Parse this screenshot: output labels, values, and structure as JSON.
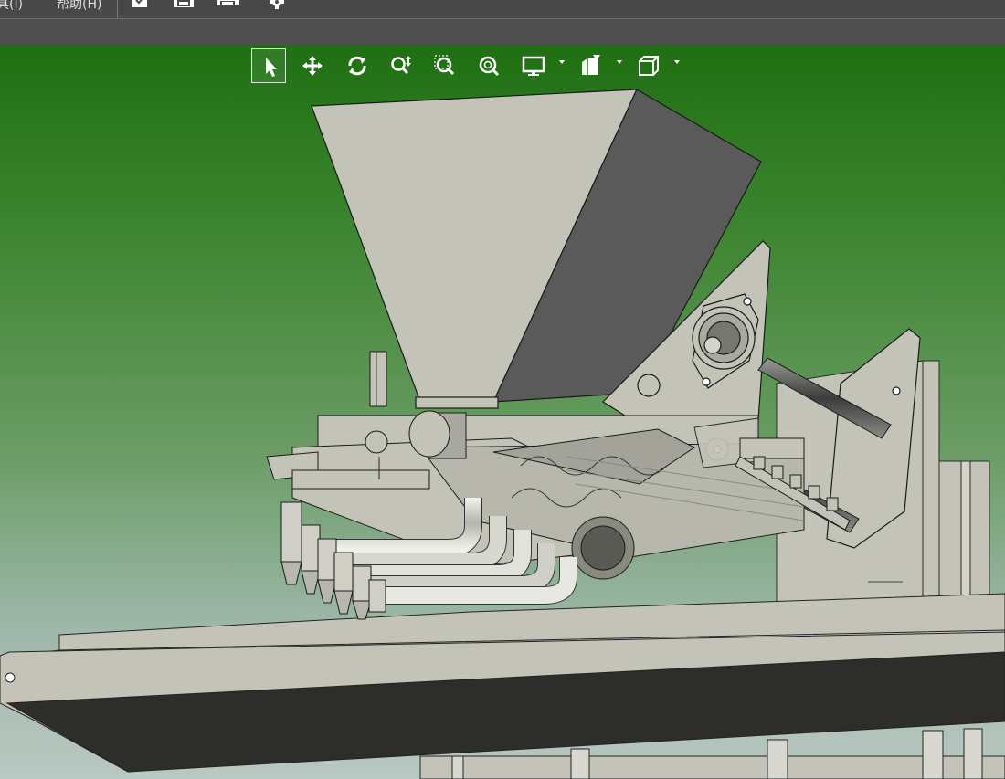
{
  "menubar": {
    "items": [
      {
        "label": "具(I)"
      },
      {
        "label": "帮助(H)"
      }
    ],
    "icons": [
      "check-document-icon",
      "save-icon",
      "print-icon",
      "settings-icon"
    ]
  },
  "view_toolbar": {
    "tools": [
      {
        "name": "select",
        "icon": "cursor-arrow-icon",
        "active": true
      },
      {
        "name": "pan",
        "icon": "move-arrows-icon"
      },
      {
        "name": "rotate",
        "icon": "rotate-icon"
      },
      {
        "name": "zoom",
        "icon": "zoom-updown-icon"
      },
      {
        "name": "zoom-window",
        "icon": "zoom-window-icon"
      },
      {
        "name": "zoom-fit",
        "icon": "zoom-fit-icon"
      },
      {
        "name": "display-style",
        "icon": "monitor-icon",
        "dropdown": true
      },
      {
        "name": "section-view",
        "icon": "section-view-icon",
        "dropdown": true
      },
      {
        "name": "standard-views",
        "icon": "cube-icon",
        "dropdown": true
      }
    ]
  },
  "viewport": {
    "background_top": "#1f6f12",
    "background_bottom": "#b9c8c2",
    "model_color": "#c4c3b8",
    "shadow_color": "#5a5a5a",
    "belt_color": "#2d2e2a"
  }
}
